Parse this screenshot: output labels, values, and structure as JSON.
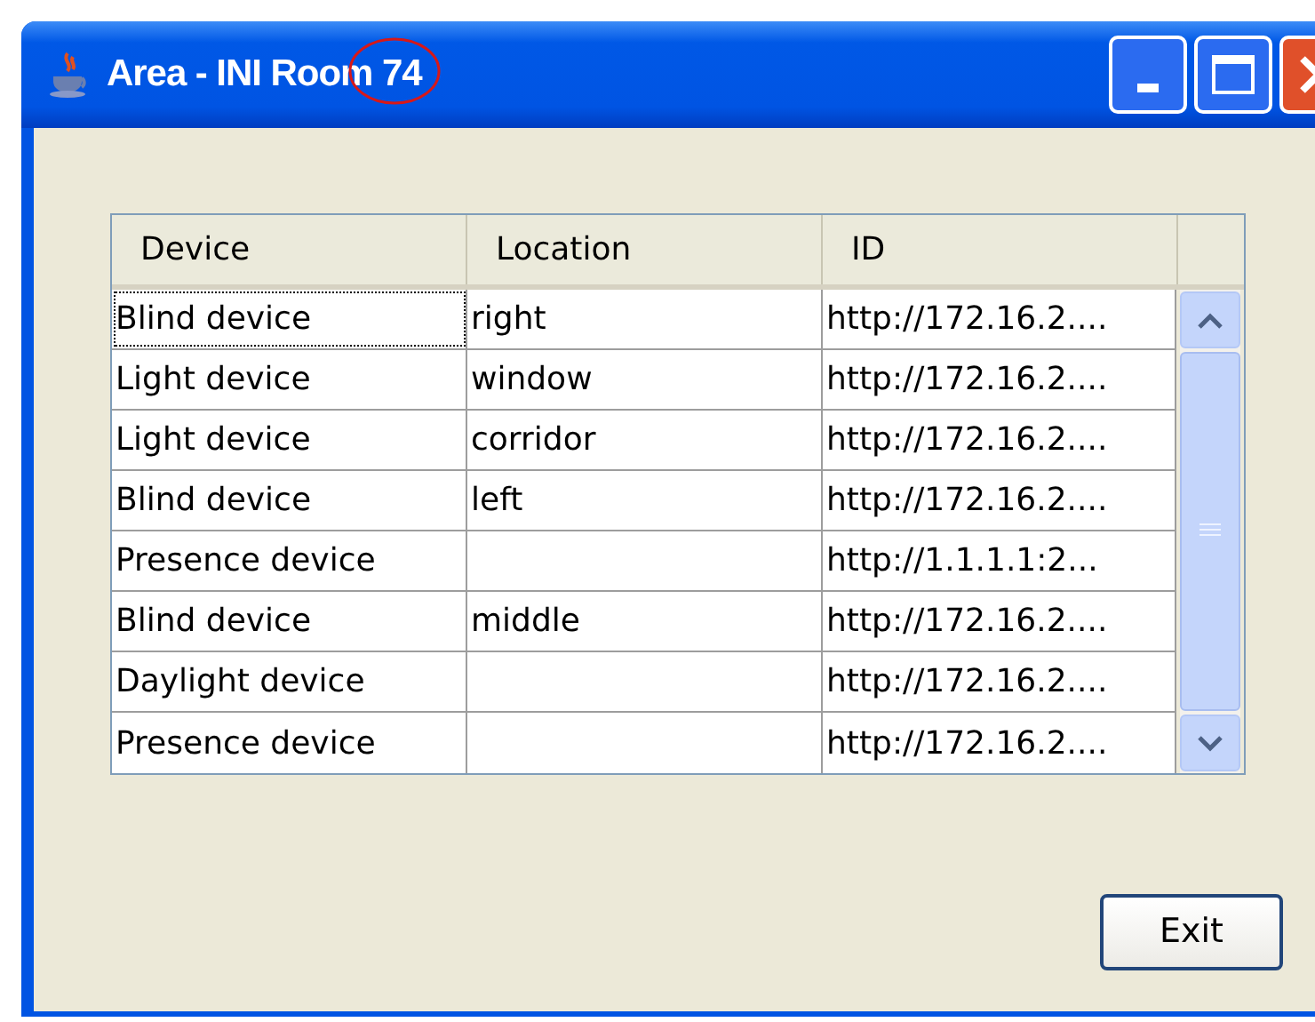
{
  "window": {
    "title": "Area - INI Room 74"
  },
  "table": {
    "columns": [
      "Device",
      "Location",
      "ID"
    ],
    "rows": [
      {
        "cells": [
          "Blind device",
          "right",
          "http://172.16.2...."
        ],
        "focused": true
      },
      {
        "cells": [
          "Light device",
          "window",
          "http://172.16.2...."
        ],
        "focused": false
      },
      {
        "cells": [
          "Light device",
          "corridor",
          "http://172.16.2...."
        ],
        "focused": false
      },
      {
        "cells": [
          "Blind device",
          "left",
          "http://172.16.2...."
        ],
        "focused": false
      },
      {
        "cells": [
          "Presence device",
          "",
          "http://1.1.1.1:2..."
        ],
        "focused": false
      },
      {
        "cells": [
          "Blind device",
          "middle",
          "http://172.16.2...."
        ],
        "focused": false
      },
      {
        "cells": [
          "Daylight device",
          "",
          "http://172.16.2...."
        ],
        "focused": false
      },
      {
        "cells": [
          "Presence device",
          "",
          "http://172.16.2...."
        ],
        "focused": false
      }
    ]
  },
  "buttons": [
    {
      "label": "Exit"
    }
  ]
}
